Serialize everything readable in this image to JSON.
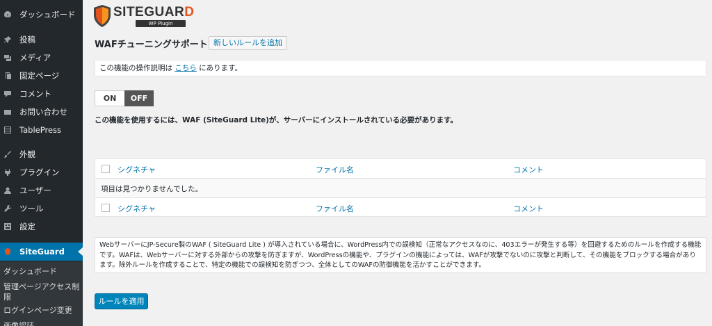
{
  "sidebar": {
    "items": [
      {
        "label": "ダッシュボード",
        "icon": "dashboard-icon"
      },
      {
        "label": "投稿",
        "icon": "pushpin-icon"
      },
      {
        "label": "メディア",
        "icon": "media-icon"
      },
      {
        "label": "固定ページ",
        "icon": "page-icon"
      },
      {
        "label": "コメント",
        "icon": "comment-icon"
      },
      {
        "label": "お問い合わせ",
        "icon": "mail-icon"
      },
      {
        "label": "TablePress",
        "icon": "table-icon"
      },
      {
        "label": "外観",
        "icon": "brush-icon"
      },
      {
        "label": "プラグイン",
        "icon": "plugin-icon"
      },
      {
        "label": "ユーザー",
        "icon": "user-icon"
      },
      {
        "label": "ツール",
        "icon": "wrench-icon"
      },
      {
        "label": "設定",
        "icon": "settings-icon"
      },
      {
        "label": "SiteGuard",
        "icon": "siteguard-icon"
      }
    ],
    "submenu": [
      "ダッシュボード",
      "管理ページアクセス制限",
      "ログインページ変更",
      "画像認証"
    ]
  },
  "logo": {
    "text_main": "SITEGUAR",
    "text_accent": "D",
    "subtitle": "WP Plugin"
  },
  "page": {
    "title": "WAFチューニングサポート",
    "add_rule_button": "新しいルールを追加"
  },
  "notice": {
    "prefix": "この機能の操作説明は ",
    "link": "こちら",
    "suffix": " にあります。"
  },
  "toggle": {
    "on_label": "ON",
    "off_label": "OFF",
    "selected": "OFF"
  },
  "requirement": "この機能を使用するには、WAF (SiteGuard Lite)が、サーバーにインストールされている必要があります。",
  "table": {
    "columns": [
      "シグネチャ",
      "ファイル名",
      "コメント"
    ],
    "empty_message": "項目は見つかりませんでした。"
  },
  "description": "WebサーバーにJP-Secure製のWAF ( SiteGuard Lite ) が導入されている場合に、WordPress内での誤検知（正常なアクセスなのに、403エラーが発生する等）を回避するためのルールを作成する機能です。WAFは、Webサーバーに対する外部からの攻撃を防ぎますが、WordPressの機能や、プラグインの機能によっては、WAFが攻撃でないのに攻撃と判断して、その機能をブロックする場合があります。除外ルールを作成することで、特定の機能での誤検知を防ぎつつ、全体としてのWAFの防御機能を活かすことができます。",
  "apply_button": "ルールを適用",
  "colors": {
    "sidebar_bg": "#23282d",
    "active_bg": "#0073aa",
    "link": "#0073aa",
    "primary_button": "#0085ba",
    "logo_accent": "#e5531a"
  }
}
